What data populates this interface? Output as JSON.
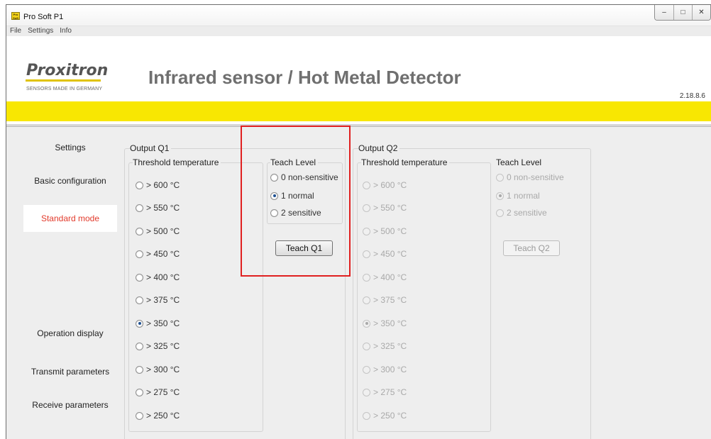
{
  "window": {
    "title": "Pro Soft P1",
    "app_icon_text": "ProSoft",
    "controls": [
      "–",
      "□",
      "✕"
    ]
  },
  "menu": {
    "items": [
      "File",
      "Settings",
      "Info"
    ]
  },
  "header": {
    "logo": "Proxitron",
    "tagline": "SENSORS MADE IN GERMANY",
    "title": "Infrared sensor  / Hot Metal Detector",
    "version": "2.18.8.6"
  },
  "sidebar": {
    "items": [
      {
        "label": "Settings"
      },
      {
        "label": "Basic configuration"
      },
      {
        "label": "Standard mode",
        "active": true
      },
      {
        "label": "Operation display"
      },
      {
        "label": "Transmit parameters"
      },
      {
        "label": "Receive parameters"
      }
    ]
  },
  "q1": {
    "title": "Output Q1",
    "threshold_title": "Threshold temperature",
    "thresholds": [
      "> 600 °C",
      "> 550 °C",
      "> 500 °C",
      "> 450 °C",
      "> 400 °C",
      "> 375 °C",
      "> 350 °C",
      "> 325 °C",
      "> 300 °C",
      "> 275 °C",
      "> 250 °C"
    ],
    "selected_threshold": "> 350 °C",
    "teach_title": "Teach Level",
    "teach_levels": [
      "0 non-sensitive",
      "1 normal",
      "2 sensitive"
    ],
    "selected_teach": "1 normal",
    "teach_button": "Teach Q1"
  },
  "q2": {
    "title": "Output Q2",
    "threshold_title": "Threshold temperature",
    "thresholds": [
      "> 600 °C",
      "> 550 °C",
      "> 500 °C",
      "> 450 °C",
      "> 400 °C",
      "> 375 °C",
      "> 350 °C",
      "> 325 °C",
      "> 300 °C",
      "> 275 °C",
      "> 250 °C"
    ],
    "selected_threshold": "> 350 °C",
    "teach_title": "Teach Level",
    "teach_levels": [
      "0 non-sensitive",
      "1 normal",
      "2 sensitive"
    ],
    "selected_teach": "1 normal",
    "teach_button": "Teach Q2",
    "enabled": false
  },
  "colors": {
    "accent_yellow": "#f8e702",
    "active_nav": "#e23a2b",
    "highlight_box": "#e02020"
  }
}
